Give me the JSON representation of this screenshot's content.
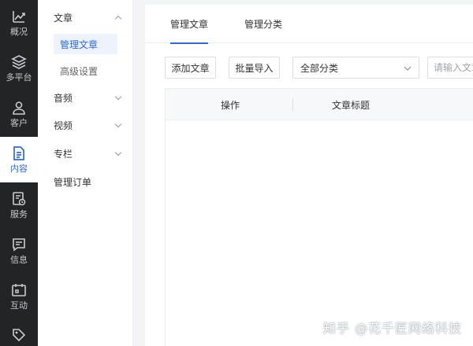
{
  "rail": {
    "items": [
      {
        "label": "概况",
        "icon": "trend-chart-icon"
      },
      {
        "label": "多平台",
        "icon": "layers-icon"
      },
      {
        "label": "客户",
        "icon": "user-icon"
      },
      {
        "label": "内容",
        "icon": "document-icon"
      },
      {
        "label": "服务",
        "icon": "service-icon"
      },
      {
        "label": "信息",
        "icon": "message-icon"
      },
      {
        "label": "互动",
        "icon": "interaction-icon"
      },
      {
        "label": "",
        "icon": "tag-icon"
      }
    ],
    "active_index": 3,
    "accent": "#2f6bd8",
    "background": "#222426"
  },
  "submenu": {
    "article": "文章",
    "article_manage": "管理文章",
    "advanced": "高级设置",
    "audio": "音频",
    "video": "视频",
    "column": "专栏",
    "orders": "管理订单"
  },
  "tabs": {
    "manage_article": "管理文章",
    "manage_category": "管理分类"
  },
  "toolbar": {
    "add_article": "添加文章",
    "batch_import": "批量导入",
    "category_select": "全部分类",
    "search_placeholder": "请输入文章"
  },
  "table": {
    "columns": [
      "操作",
      "文章标题"
    ]
  },
  "watermark": "知乎 @花千匠网络科技"
}
